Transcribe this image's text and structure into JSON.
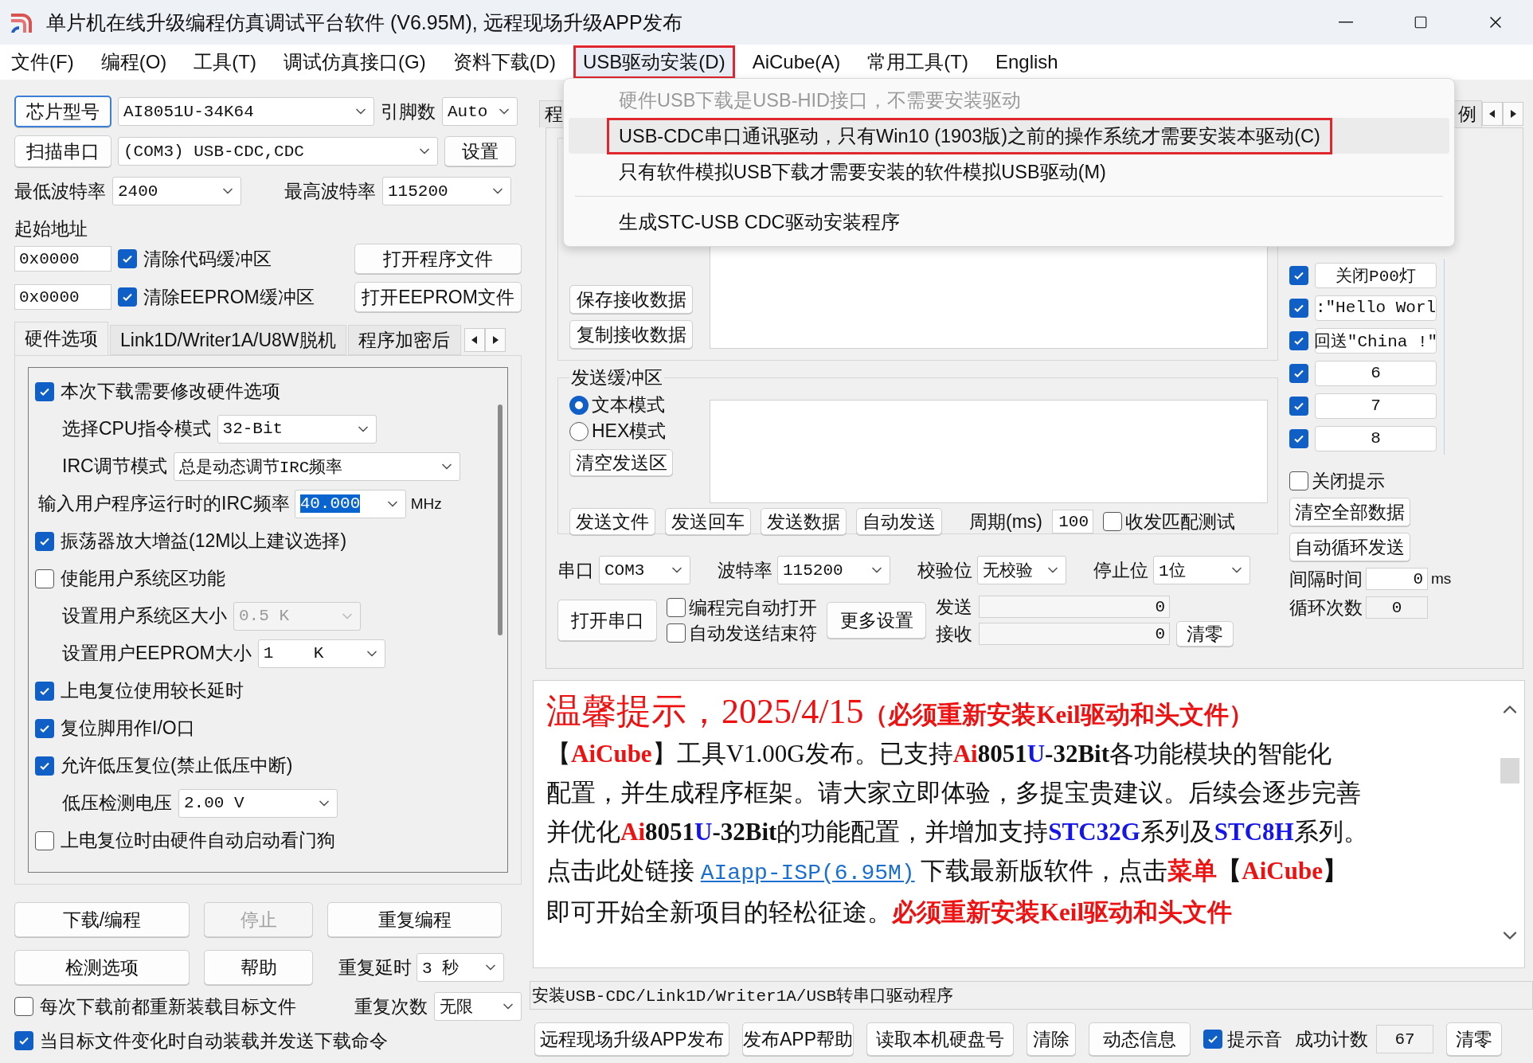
{
  "window": {
    "title": "单片机在线升级编程仿真调试平台软件 (V6.95M), 远程现场升级APP发布"
  },
  "menu": [
    {
      "label": "文件(F)",
      "open": false,
      "annotated": false
    },
    {
      "label": "编程(O)",
      "open": false,
      "annotated": false
    },
    {
      "label": "工具(T)",
      "open": false,
      "annotated": false
    },
    {
      "label": "调试仿真接口(G)",
      "open": false,
      "annotated": false
    },
    {
      "label": "资料下载(D)",
      "open": false,
      "annotated": false
    },
    {
      "label": "USB驱动安装(D)",
      "open": true,
      "annotated": true,
      "dropdown": [
        {
          "kind": "item",
          "label": "硬件USB下载是USB-HID接口，不需要安装驱动",
          "disabled": true,
          "highlighted": false,
          "annotated": false
        },
        {
          "kind": "item",
          "label": "USB-CDC串口通讯驱动，只有Win10 (1903版)之前的操作系统才需要安装本驱动(C)",
          "disabled": false,
          "highlighted": true,
          "annotated": true
        },
        {
          "kind": "item",
          "label": "只有软件模拟USB下载才需要安装的软件模拟USB驱动(M)",
          "disabled": false,
          "highlighted": false,
          "annotated": false
        },
        {
          "kind": "separator"
        },
        {
          "kind": "item",
          "label": "生成STC-USB CDC驱动安装程序",
          "disabled": false,
          "highlighted": false,
          "annotated": false
        }
      ]
    },
    {
      "label": "AiCube(A)",
      "open": false,
      "annotated": false
    },
    {
      "label": "常用工具(T)",
      "open": false,
      "annotated": false
    },
    {
      "label": "English",
      "open": false,
      "annotated": false
    }
  ],
  "chip": {
    "button": {
      "label": "芯片型号",
      "focused": true
    },
    "model": "AI8051U-34K64",
    "pins_label": "引脚数",
    "pins": "Auto"
  },
  "port": {
    "button": "扫描串口",
    "value": "(COM3) USB-CDC,CDC",
    "settings": "设置"
  },
  "baud": {
    "min_label": "最低波特率",
    "min": "2400",
    "max_label": "最高波特率",
    "max": "115200"
  },
  "start_address": {
    "label": "起始地址",
    "rows": [
      {
        "address": "0x0000",
        "check_label": "清除代码缓冲区",
        "checked": true,
        "button": "打开程序文件"
      },
      {
        "address": "0x0000",
        "check_label": "清除EEPROM缓冲区",
        "checked": true,
        "button": "打开EEPROM文件"
      }
    ]
  },
  "left_tabs": [
    {
      "label": "硬件选项",
      "selected": true
    },
    {
      "label": "Link1D/Writer1A/U8W脱机",
      "selected": false
    },
    {
      "label": "程序加密后",
      "selected": false
    }
  ],
  "hardware_options": [
    {
      "kind": "check",
      "label": "本次下载需要修改硬件选项",
      "checked": true
    },
    {
      "kind": "select",
      "label": "选择CPU指令模式",
      "value": "32-Bit",
      "disabled": false
    },
    {
      "kind": "select",
      "label": "IRC调节模式",
      "value": "总是动态调节IRC频率",
      "disabled": false
    },
    {
      "kind": "input",
      "label": "输入用户程序运行时的IRC频率",
      "value": "40.000",
      "value_selected": true,
      "unit": "MHz"
    },
    {
      "kind": "check",
      "label": "振荡器放大增益(12M以上建议选择)",
      "checked": true
    },
    {
      "kind": "check",
      "label": "使能用户系统区功能",
      "checked": false
    },
    {
      "kind": "select",
      "label": "设置用户系统区大小",
      "value": "0.5 K",
      "disabled": true
    },
    {
      "kind": "select",
      "label": "设置用户EEPROM大小",
      "value": "1    K",
      "disabled": false
    },
    {
      "kind": "check",
      "label": "上电复位使用较长延时",
      "checked": true
    },
    {
      "kind": "check",
      "label": "复位脚用作I/O口",
      "checked": true
    },
    {
      "kind": "check",
      "label": "允许低压复位(禁止低压中断)",
      "checked": true
    },
    {
      "kind": "select",
      "label": "低压检测电压",
      "value": "2.00 V",
      "disabled": false
    },
    {
      "kind": "check",
      "label": "上电复位时由硬件自动启动看门狗",
      "checked": false
    }
  ],
  "actions": [
    {
      "label": "下载/编程",
      "disabled": false
    },
    {
      "label": "停止",
      "disabled": true
    },
    {
      "label": "重复编程",
      "disabled": false
    },
    {
      "label": "检测选项",
      "disabled": false
    },
    {
      "label": "帮助",
      "disabled": false
    }
  ],
  "repeat": {
    "delay_label": "重复延时",
    "delay": "3 秒",
    "count_label": "重复次数",
    "count": "无限"
  },
  "bottom_checks": [
    {
      "label": "每次下载前都重新装载目标文件",
      "checked": false
    },
    {
      "label": "当目标文件变化时自动装载并发送下载命令",
      "checked": true
    }
  ],
  "right_tabs": [
    "程",
    "例"
  ],
  "serial": {
    "receive_buttons": [
      "保存接收数据",
      "复制接收数据"
    ],
    "send": {
      "title": "发送缓冲区",
      "modes": [
        {
          "label": "文本模式",
          "selected": true
        },
        {
          "label": "HEX模式",
          "selected": false
        }
      ],
      "clear": "清空发送区",
      "buttons": [
        "发送文件",
        "发送回车",
        "发送数据",
        "自动发送"
      ],
      "period_label": "周期(ms)",
      "period": "100",
      "match_label": "收发匹配测试",
      "match_checked": false
    },
    "settings": [
      {
        "label": "串口",
        "value": "COM3"
      },
      {
        "label": "波特率",
        "value": "115200"
      },
      {
        "label": "校验位",
        "value": "无校验"
      },
      {
        "label": "停止位",
        "value": "1位"
      }
    ],
    "open_button": "打开串口",
    "options": [
      {
        "label": "编程完自动打开",
        "checked": false
      },
      {
        "label": "自动发送结束符",
        "checked": false
      }
    ],
    "more": "更多设置",
    "counters": [
      {
        "label": "发送",
        "value": "0"
      },
      {
        "label": "接收",
        "value": "0"
      }
    ],
    "clear": "清零"
  },
  "quick_send": [
    {
      "label": "关闭P00灯",
      "checked": true
    },
    {
      "label": ":\"Hello Worl",
      "checked": true
    },
    {
      "label": "回送\"China !\"",
      "checked": true
    },
    {
      "label": "6",
      "checked": true
    },
    {
      "label": "7",
      "checked": true
    },
    {
      "label": "8",
      "checked": true
    }
  ],
  "quick_controls": {
    "close_hint": {
      "label": "关闭提示",
      "checked": false
    },
    "buttons": [
      "清空全部数据",
      "自动循环发送"
    ],
    "interval_label": "间隔时间",
    "interval": "0",
    "interval_unit": "ms",
    "loops_label": "循环次数",
    "loops": "0"
  },
  "notice": [
    [
      {
        "kind": "headline",
        "text": "温馨提示，2025/4/15"
      },
      {
        "kind": "red",
        "text": "（必须重新安装Keil驱动和头文件）"
      }
    ],
    [
      {
        "kind": "plain",
        "text": "【"
      },
      {
        "kind": "red",
        "text": "AiCube"
      },
      {
        "kind": "plain",
        "text": "】工具V1.00G发布。已支持"
      },
      {
        "kind": "red",
        "text": "Ai"
      },
      {
        "kind": "bold",
        "text": "8051"
      },
      {
        "kind": "blue",
        "text": "U"
      },
      {
        "kind": "bold",
        "text": "-32Bit"
      },
      {
        "kind": "plain",
        "text": "各功能模块的智能化"
      }
    ],
    [
      {
        "kind": "plain",
        "text": "配置，并生成程序框架。请大家立即体验，多提宝贵建议。后续会逐步完善"
      }
    ],
    [
      {
        "kind": "plain",
        "text": "并优化"
      },
      {
        "kind": "red",
        "text": "Ai"
      },
      {
        "kind": "bold",
        "text": "8051"
      },
      {
        "kind": "blue",
        "text": "U"
      },
      {
        "kind": "bold",
        "text": "-32Bit"
      },
      {
        "kind": "plain",
        "text": "的功能配置，并增加支持"
      },
      {
        "kind": "blue",
        "text": "STC32G"
      },
      {
        "kind": "plain",
        "text": "系列及"
      },
      {
        "kind": "blue",
        "text": "STC8H"
      },
      {
        "kind": "plain",
        "text": "系列。"
      }
    ],
    [
      {
        "kind": "plain",
        "text": "点击此处链接 "
      },
      {
        "kind": "link",
        "text": "AIapp-ISP(6.95M)"
      },
      {
        "kind": "plain",
        "text": " 下载最新版软件，点击"
      },
      {
        "kind": "red",
        "text": "菜单"
      },
      {
        "kind": "bold",
        "text": "【"
      },
      {
        "kind": "red",
        "text": "AiCube"
      },
      {
        "kind": "bold",
        "text": "】"
      }
    ],
    [
      {
        "kind": "plain",
        "text": "即可开始全新项目的轻松征途。"
      },
      {
        "kind": "red",
        "text": "必须重新安装Keil驱动和头文件"
      }
    ]
  ],
  "status_line": "安装USB-CDC/Link1D/Writer1A/USB转串口驱动程序",
  "bottom_bar": {
    "buttons": [
      "远程现场升级APP发布",
      "发布APP帮助",
      "读取本机硬盘号",
      "清除",
      "动态信息"
    ],
    "sound": {
      "label": "提示音",
      "checked": true
    },
    "count_label": "成功计数",
    "count": "67",
    "reset": "清零"
  }
}
